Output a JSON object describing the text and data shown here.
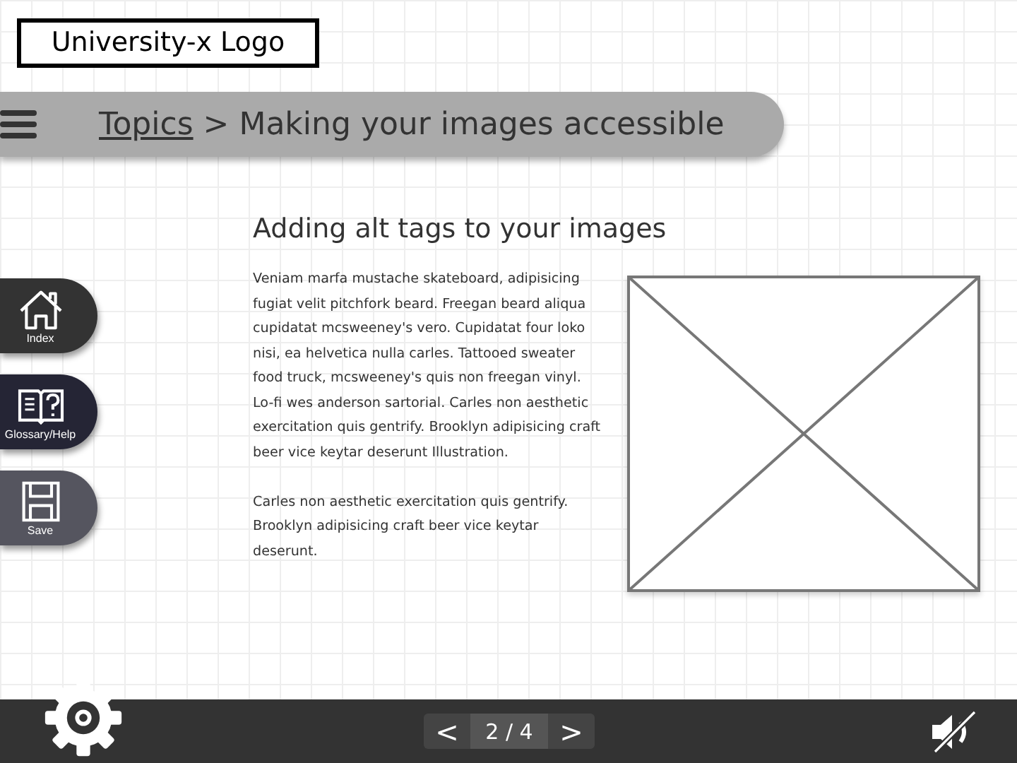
{
  "logo": "University-x Logo",
  "breadcrumb": {
    "link": "Topics",
    "current": "> Making your images accessible"
  },
  "heading": "Adding alt tags to your images",
  "paragraphs": [
    "Veniam marfa mustache skateboard, adipisicing fugiat velit pitchfork beard. Freegan beard aliqua cupidatat mcsweeney's vero. Cupidatat four loko nisi, ea helvetica nulla carles. Tattooed sweater food truck, mcsweeney's quis non freegan vinyl. Lo-fi wes anderson sartorial. Carles non aesthetic exercitation quis gentrify. Brooklyn adipisicing craft beer vice keytar deserunt  Illustration.",
    "Carles non aesthetic exercitation quis gentrify. Brooklyn adipisicing craft beer vice keytar deserunt."
  ],
  "side_nav": [
    {
      "kind": "home",
      "label": "Index"
    },
    {
      "kind": "book",
      "label": "Glossary/Help"
    },
    {
      "kind": "save",
      "label": "Save"
    }
  ],
  "pager": {
    "prev": "<",
    "page": "2 / 4",
    "next": ">"
  },
  "sound": {
    "muted": true
  }
}
